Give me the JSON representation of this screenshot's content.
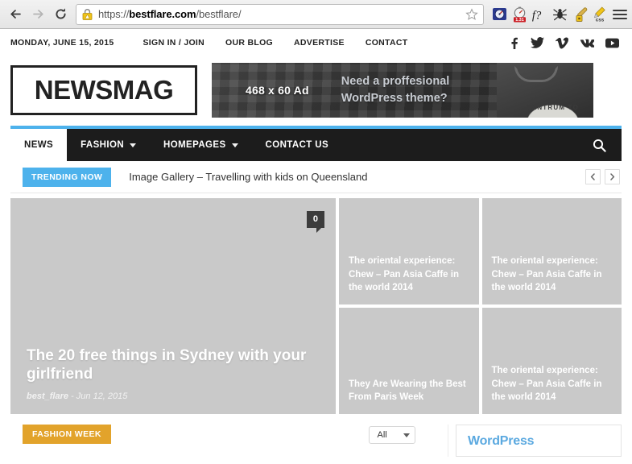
{
  "browser": {
    "back_icon": "back-arrow-icon",
    "forward_icon": "forward-arrow-icon",
    "reload_icon": "reload-icon",
    "url_scheme": "https://",
    "url_host": "bestflare.com",
    "url_path": "/bestflare/",
    "url_full": "https://bestflare.com/bestflare/",
    "lock_icon": "warning-padlock-icon",
    "bookmark_icon": "star-outline-icon",
    "extensions": [
      {
        "name": "speedometer-extension-icon",
        "label": ""
      },
      {
        "name": "page-speed-timer-icon",
        "label": "1.31"
      },
      {
        "name": "font-inspector-icon",
        "label": "f?"
      },
      {
        "name": "web-developer-bug-icon",
        "label": ""
      },
      {
        "name": "color-picker-eyedropper-icon",
        "label": ""
      },
      {
        "name": "css-editor-pencil-icon",
        "label": "css"
      }
    ],
    "menu_icon": "hamburger-menu-icon"
  },
  "topbar": {
    "date": "MONDAY, JUNE 15, 2015",
    "links": [
      "SIGN IN / JOIN",
      "OUR BLOG",
      "ADVERTISE",
      "CONTACT"
    ],
    "social": [
      {
        "name": "facebook-icon",
        "glyph": "f"
      },
      {
        "name": "twitter-icon",
        "glyph": "t"
      },
      {
        "name": "vimeo-icon",
        "glyph": "v"
      },
      {
        "name": "vk-icon",
        "glyph": "vk"
      },
      {
        "name": "youtube-icon",
        "glyph": "yt"
      }
    ]
  },
  "header": {
    "logo": "NEWSMAG",
    "ad": {
      "size_label": "468 x 60 Ad",
      "message_line1": "Need a proffesional",
      "message_line2": "WordPress theme?",
      "shirt_label": "TANTRUM TO"
    }
  },
  "nav": {
    "items": [
      {
        "label": "NEWS",
        "has_dropdown": false,
        "active": true
      },
      {
        "label": "FASHION",
        "has_dropdown": true,
        "active": false
      },
      {
        "label": "HOMEPAGES",
        "has_dropdown": true,
        "active": false
      },
      {
        "label": "CONTACT US",
        "has_dropdown": false,
        "active": false
      }
    ],
    "search_icon": "search-icon",
    "accent_color": "#4db2ec",
    "bar_color": "#1c1c1c"
  },
  "trending": {
    "badge": "TRENDING NOW",
    "headline": "Image Gallery – Travelling with kids on Queensland",
    "prev_icon": "chevron-left-icon",
    "next_icon": "chevron-right-icon",
    "badge_color": "#4db2ec"
  },
  "mosaic": {
    "featured": {
      "title": "The 20 free things in Sydney with your girlfriend",
      "author": "best_flare",
      "separator": "-",
      "date": "Jun 12, 2015",
      "comments": "0",
      "comment_icon": "comment-bubble-icon"
    },
    "tiles": [
      {
        "title": "The oriental experience: Chew – Pan Asia Caffe in the world 2014"
      },
      {
        "title": "The oriental experience: Chew – Pan Asia Caffe in the world 2014"
      },
      {
        "title": "They Are Wearing the Best From Paris Week"
      },
      {
        "title": "The oriental experience: Chew – Pan Asia Caffe in the world 2014"
      }
    ]
  },
  "bottom": {
    "category_badge": "FASHION WEEK",
    "category_color": "#e2a32b",
    "filter_value": "All",
    "filter_caret_icon": "chevron-down-icon",
    "widget_title": "WordPress",
    "widget_title_color": "#5ba9e0"
  }
}
